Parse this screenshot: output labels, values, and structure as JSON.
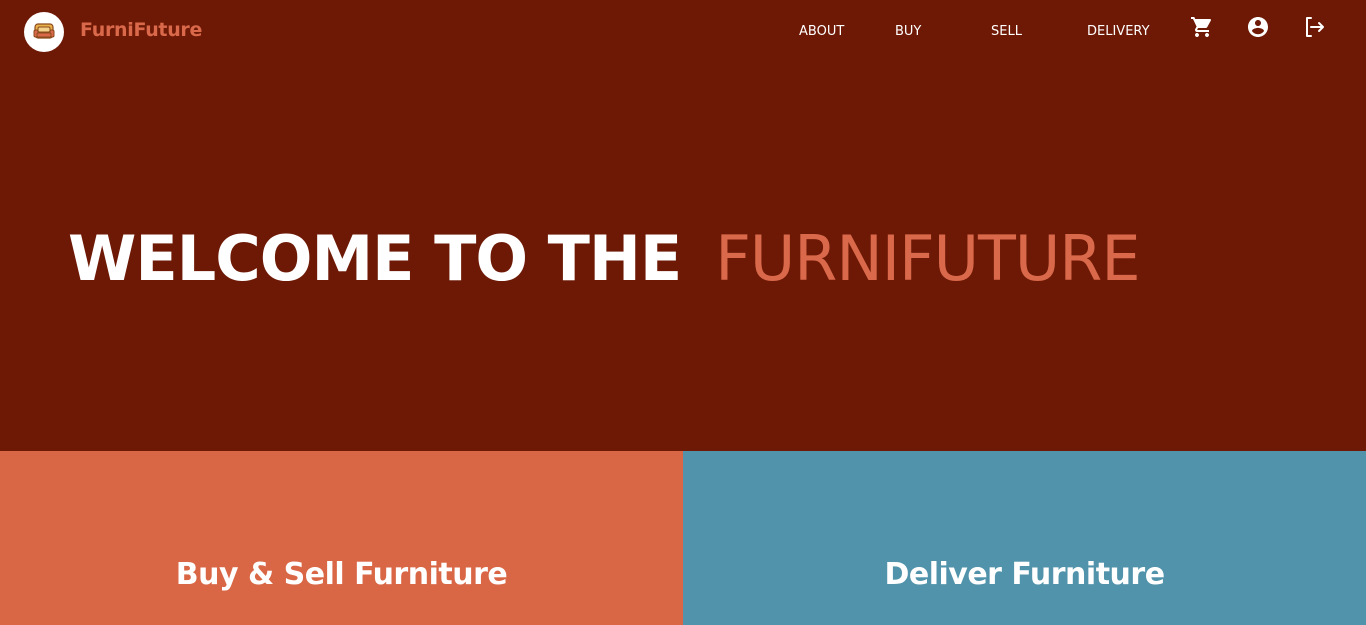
{
  "brand": {
    "name": "FurniFuture",
    "logo_icon": "sofa-icon"
  },
  "nav": {
    "links": [
      "ABOUT",
      "BUY",
      "SELL",
      "DELIVERY"
    ],
    "icons": [
      "cart-icon",
      "account-circle-icon",
      "logout-icon"
    ]
  },
  "hero": {
    "part1": "WELCOME TO THE",
    "part2": "FURNIFUTURE"
  },
  "panels": {
    "left": {
      "title": "Buy & Sell Furniture",
      "color": "#d96746"
    },
    "right": {
      "title": "Deliver Furniture",
      "color": "#5093aa"
    }
  },
  "colors": {
    "background": "#6e1906",
    "accent": "#d9694a",
    "text": "#ffffff"
  }
}
